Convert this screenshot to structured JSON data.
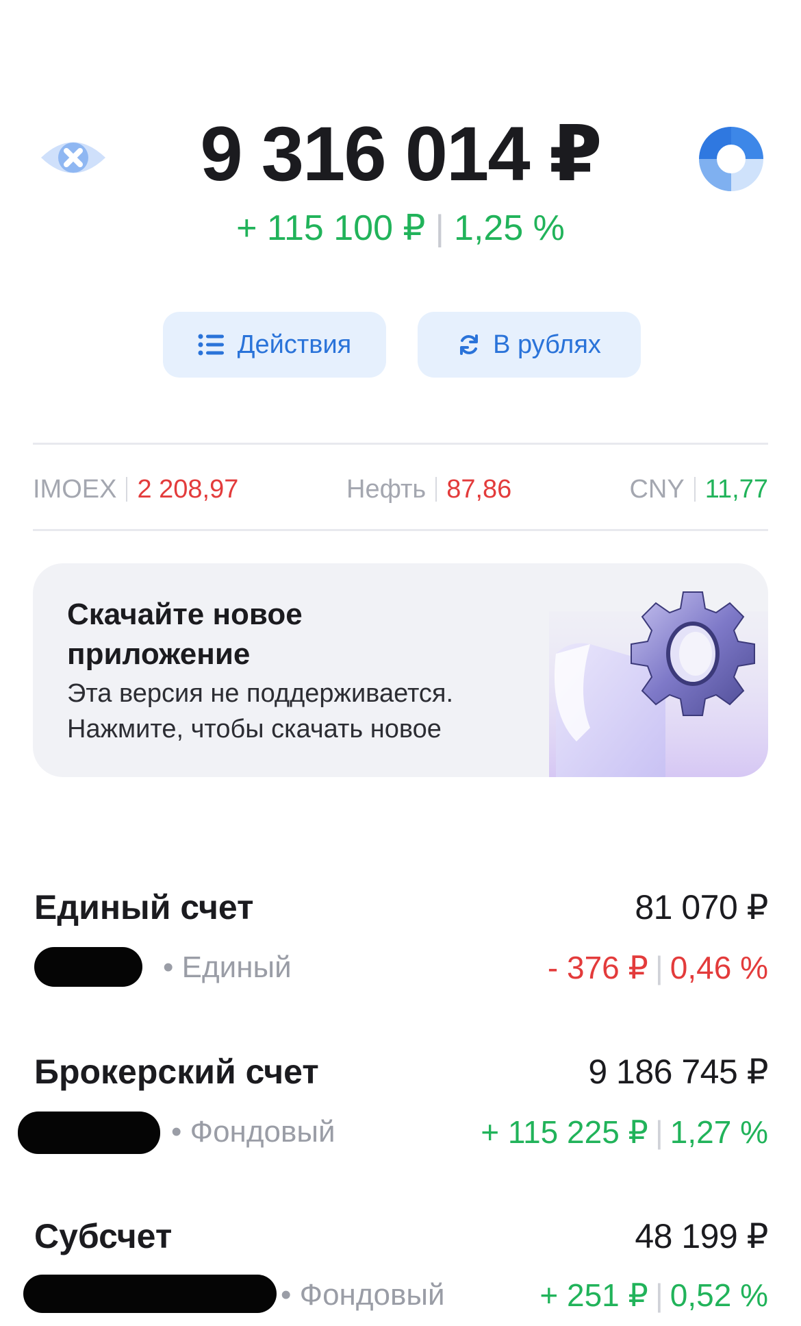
{
  "portfolio": {
    "total": "9 316 014 ₽",
    "change_abs": "+ 115 100 ₽",
    "change_pct": "1,25 %"
  },
  "buttons": {
    "actions": "Действия",
    "currency": "В рублях"
  },
  "tickers": [
    {
      "name": "IMOEX",
      "value": "2 208,97",
      "trend": "down"
    },
    {
      "name": "Нефть",
      "value": "87,86",
      "trend": "down"
    },
    {
      "name": "CNY",
      "value": "11,77",
      "trend": "up"
    }
  ],
  "banner": {
    "title": "Скачайте новое приложение",
    "subtitle_line1": "Эта версия не поддерживается.",
    "subtitle_line2": "Нажмите, чтобы скачать новое"
  },
  "accounts": [
    {
      "title": "Единый счет",
      "sum": "81 070 ₽",
      "type": "• Единый",
      "change_abs": "- 376 ₽",
      "change_pct": "0,46 %",
      "trend": "down"
    },
    {
      "title": "Брокерский счет",
      "sum": "9 186 745 ₽",
      "type": "• Фондовый",
      "change_abs": "+ 115 225 ₽",
      "change_pct": "1,27 %",
      "trend": "up"
    },
    {
      "title": "Субсчет",
      "sum": "48 199 ₽",
      "type": "• Фондовый",
      "change_abs": "+ 251 ₽",
      "change_pct": "0,52 %",
      "trend": "up"
    }
  ],
  "colors": {
    "accent": "#2a73d9",
    "positive": "#21b35a",
    "negative": "#e33b3b"
  },
  "icons": [
    "hide-balance-eye-icon",
    "portfolio-pie-icon",
    "list-icon",
    "refresh-icon",
    "gear-illustration"
  ]
}
